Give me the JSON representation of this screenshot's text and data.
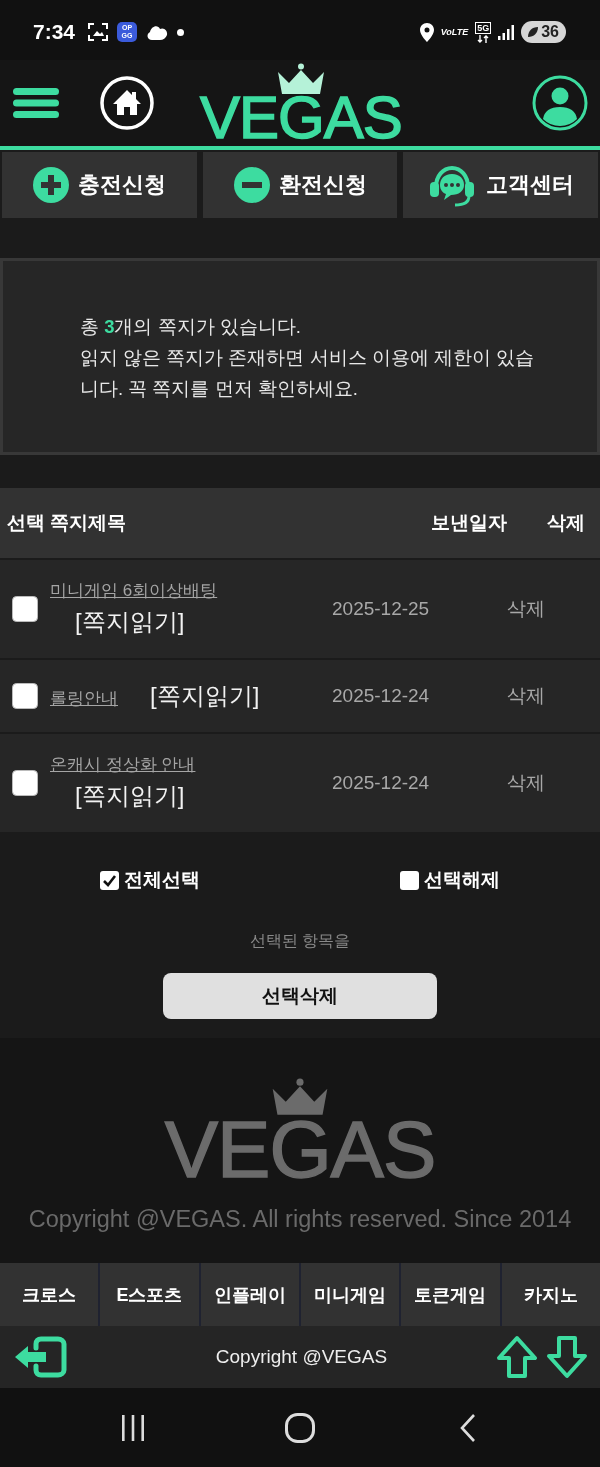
{
  "status_bar": {
    "time": "7:34",
    "app_badge": "OP GG",
    "volte": "VoLTE",
    "network": "5G",
    "battery": "36"
  },
  "header": {
    "logo": "VEGAS"
  },
  "actions": [
    {
      "kind": "deposit",
      "label": "충전신청"
    },
    {
      "kind": "withdraw",
      "label": "환전신청"
    },
    {
      "kind": "support",
      "label": "고객센터"
    }
  ],
  "notice": {
    "count_line": "총 **3**개의 쪽지가 있습니다.",
    "warning": "읽지 않은 쪽지가 존재하면 서비스 이용에 제한이 있습니다. 꼭 쪽지를 먼저 확인하세요."
  },
  "table": {
    "columns": [
      "선택 쪽지제목",
      "보낸일자",
      "삭제"
    ],
    "rows": [
      {
        "checked": false,
        "title": "미니게임 6회이상배팅",
        "read_link": "[쪽지읽기]",
        "date": "2025-12-25",
        "delete": "삭제"
      },
      {
        "checked": false,
        "title": "롤링안내",
        "read_link": "[쪽지읽기]",
        "date": "2025-12-24",
        "delete": "삭제"
      },
      {
        "checked": false,
        "title": "온캐시 정상화 안내",
        "read_link": "[쪽지읽기]",
        "date": "2025-12-24",
        "delete": "삭제"
      }
    ]
  },
  "bulk": {
    "select_all": {
      "label": "전체선택",
      "checked": true
    },
    "deselect": {
      "label": "선택해제",
      "checked": false
    },
    "hint": "선택된 항목을",
    "button": "선택삭제"
  },
  "footer": {
    "logo": "VEGAS",
    "copyright": "Copyright @VEGAS. All rights reserved. Since 2014"
  },
  "bottom_nav": [
    "크로스",
    "E스포츠",
    "인플레이",
    "미니게임",
    "토큰게임",
    "카지노"
  ],
  "bottom_bar": {
    "copyright": "Copyright @VEGAS"
  }
}
